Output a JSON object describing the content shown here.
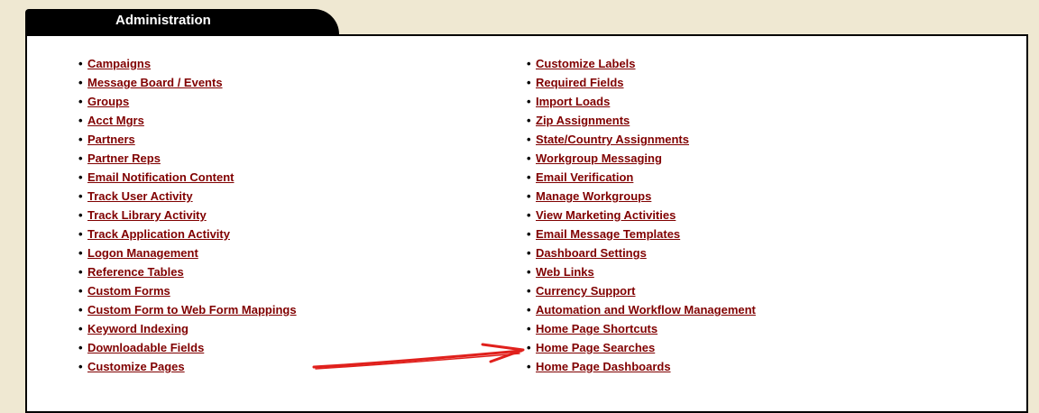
{
  "tab": {
    "title": "Administration"
  },
  "columns": {
    "left": [
      "Campaigns",
      "Message Board / Events",
      "Groups",
      "Acct Mgrs",
      "Partners",
      "Partner Reps",
      "Email Notification Content",
      "Track User Activity",
      "Track Library Activity",
      "Track Application Activity",
      "Logon Management",
      "Reference Tables",
      "Custom Forms",
      "Custom Form to Web Form Mappings",
      "Keyword Indexing",
      "Downloadable Fields",
      "Customize Pages"
    ],
    "right": [
      "Customize Labels",
      "Required Fields",
      "Import Loads",
      "Zip Assignments",
      "State/Country Assignments",
      "Workgroup Messaging",
      "Email Verification",
      "Manage Workgroups",
      "View Marketing Activities",
      "Email Message Templates",
      "Dashboard Settings",
      "Web Links",
      "Currency Support",
      "Automation and Workflow Management",
      "Home Page Shortcuts",
      "Home Page Searches",
      "Home Page Dashboards"
    ]
  },
  "colors": {
    "background": "#efe8d2",
    "link": "#800000",
    "arrow": "#e0201c"
  }
}
